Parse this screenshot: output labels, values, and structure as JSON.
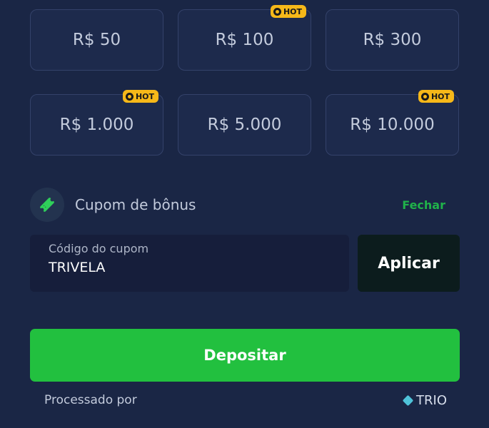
{
  "amounts": [
    {
      "label": "R$ 50",
      "hot": false
    },
    {
      "label": "R$ 100",
      "hot": true
    },
    {
      "label": "R$ 300",
      "hot": false
    },
    {
      "label": "R$ 1.000",
      "hot": true
    },
    {
      "label": "R$ 5.000",
      "hot": false
    },
    {
      "label": "R$ 10.000",
      "hot": true
    }
  ],
  "hot_label": "HOT",
  "coupon": {
    "icon": "ticket-icon",
    "label": "Cupom de bônus",
    "close_label": "Fechar",
    "field_label": "Código do cupom",
    "field_value": "TRIVELA",
    "apply_label": "Aplicar"
  },
  "deposit_label": "Depositar",
  "footer": {
    "processed_label": "Processado por",
    "provider_name": "TRIO",
    "provider_icon": "diamond-icon"
  },
  "colors": {
    "background": "#1a2645",
    "accent_green": "#22c03f",
    "hot_badge": "#f6b819",
    "link_green": "#20b24a"
  }
}
